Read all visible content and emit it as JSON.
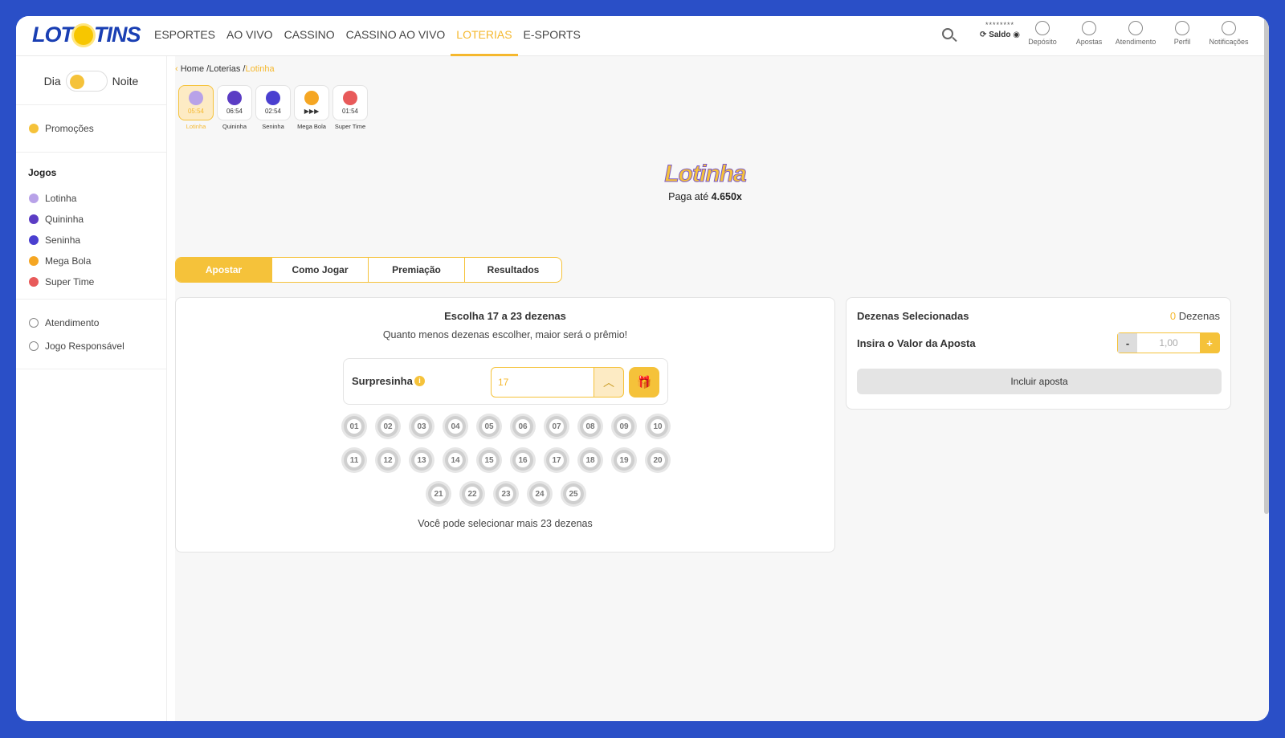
{
  "logo": {
    "left": "LOT",
    "right": "TINS"
  },
  "nav": [
    {
      "label": "ESPORTES",
      "active": false
    },
    {
      "label": "AO VIVO",
      "active": false
    },
    {
      "label": "CASSINO",
      "active": false
    },
    {
      "label": "CASSINO AO VIVO",
      "active": false
    },
    {
      "label": "LOTERIAS",
      "active": true
    },
    {
      "label": "E-SPORTS",
      "active": false
    }
  ],
  "header": {
    "saldo_mask": "********",
    "saldo_label": "Saldo",
    "icons": [
      "Depósito",
      "Apostas",
      "Atendimento",
      "Perfil",
      "Notificações"
    ]
  },
  "sidebar": {
    "day": "Dia",
    "night": "Noite",
    "promo": "Promoções",
    "games_title": "Jogos",
    "games": [
      "Lotinha",
      "Quininha",
      "Seninha",
      "Mega Bola",
      "Super Time"
    ],
    "support": [
      "Atendimento",
      "Jogo Responsável"
    ]
  },
  "breadcrumb": {
    "home": "Home",
    "sep1": "/",
    "section": "Loterias",
    "sep2": "/",
    "current": "Lotinha"
  },
  "games": [
    {
      "time": "05:54",
      "name": "Lotinha",
      "color": "#b8a2e8",
      "active": true
    },
    {
      "time": "06:54",
      "name": "Quininha",
      "color": "#5b3cc4",
      "active": false
    },
    {
      "time": "02:54",
      "name": "Seninha",
      "color": "#4a3fd0",
      "active": false
    },
    {
      "time": "▶▶▶",
      "name": "Mega Bola",
      "color": "#f5a623",
      "active": false
    },
    {
      "time": "01:54",
      "name": "Super Time",
      "color": "#e85a5a",
      "active": false
    }
  ],
  "brand": {
    "title": "Lotinha",
    "pay_prefix": "Paga até",
    "pay_value": "4.650x"
  },
  "tabs": [
    "Apostar",
    "Como Jogar",
    "Premiação",
    "Resultados"
  ],
  "bet": {
    "title": "Escolha 17 a 23 dezenas",
    "subtitle": "Quanto menos dezenas escolher, maior será o prêmio!",
    "surpresinha_label": "Surpresinha",
    "surpresinha_value": "17",
    "numbers": [
      "01",
      "02",
      "03",
      "04",
      "05",
      "06",
      "07",
      "08",
      "09",
      "10",
      "11",
      "12",
      "13",
      "14",
      "15",
      "16",
      "17",
      "18",
      "19",
      "20",
      "21",
      "22",
      "23",
      "24",
      "25"
    ],
    "more_prefix": "Você pode selecionar mais",
    "more_count": "23",
    "more_suffix": "dezenas"
  },
  "summary": {
    "selected_label": "Dezenas Selecionadas",
    "selected_count": "0",
    "selected_unit": "Dezenas",
    "value_label": "Insira o Valor da Aposta",
    "minus": "-",
    "value": "1,00",
    "plus": "+",
    "include": "Incluir aposta"
  }
}
